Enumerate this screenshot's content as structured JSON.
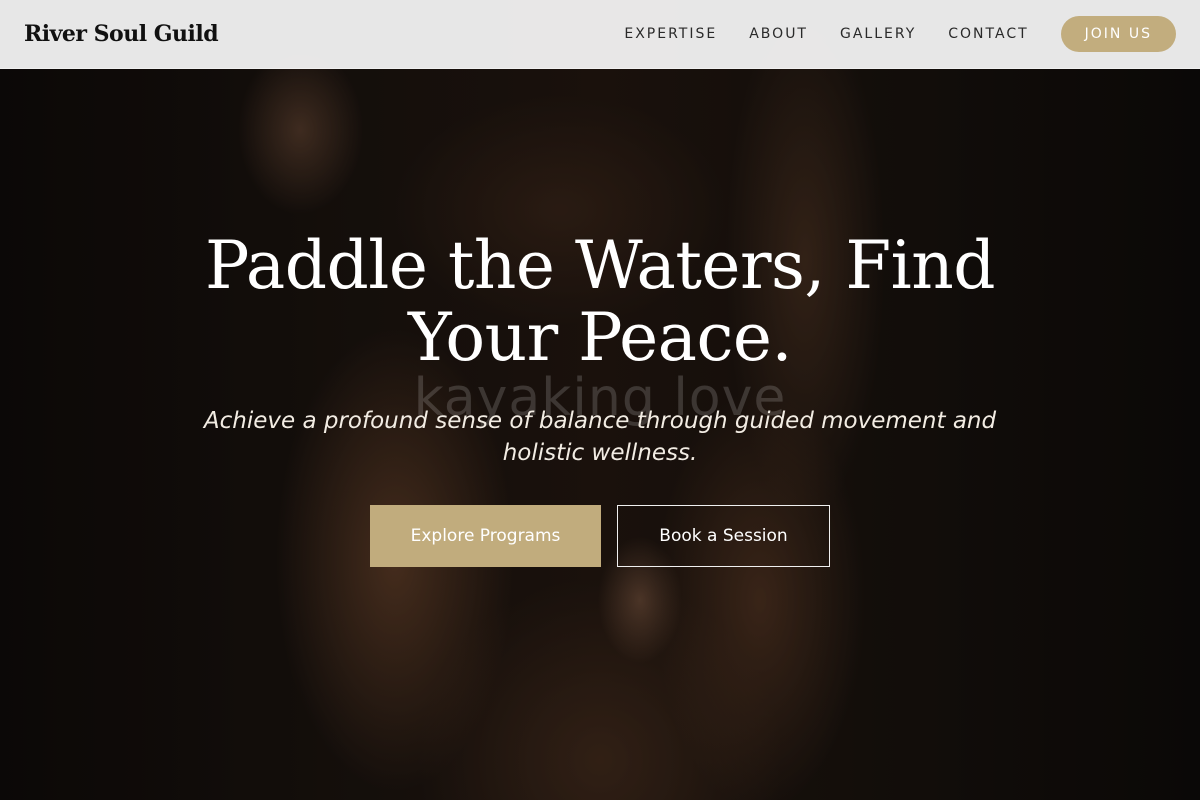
{
  "header": {
    "brand": "River Soul Guild",
    "nav": [
      "EXPERTISE",
      "ABOUT",
      "GALLERY",
      "CONTACT"
    ],
    "join_label": "JOIN US"
  },
  "hero": {
    "title": "Paddle the Waters, Find Your Peace.",
    "watermark": "kayaking love",
    "subtitle": "Achieve a profound sense of balance through guided movement and holistic wellness.",
    "primary_cta": "Explore Programs",
    "secondary_cta": "Book a Session"
  },
  "colors": {
    "accent": "#c2ad7e",
    "header_bg": "#f0f0f0",
    "text_light": "#ffffff"
  }
}
